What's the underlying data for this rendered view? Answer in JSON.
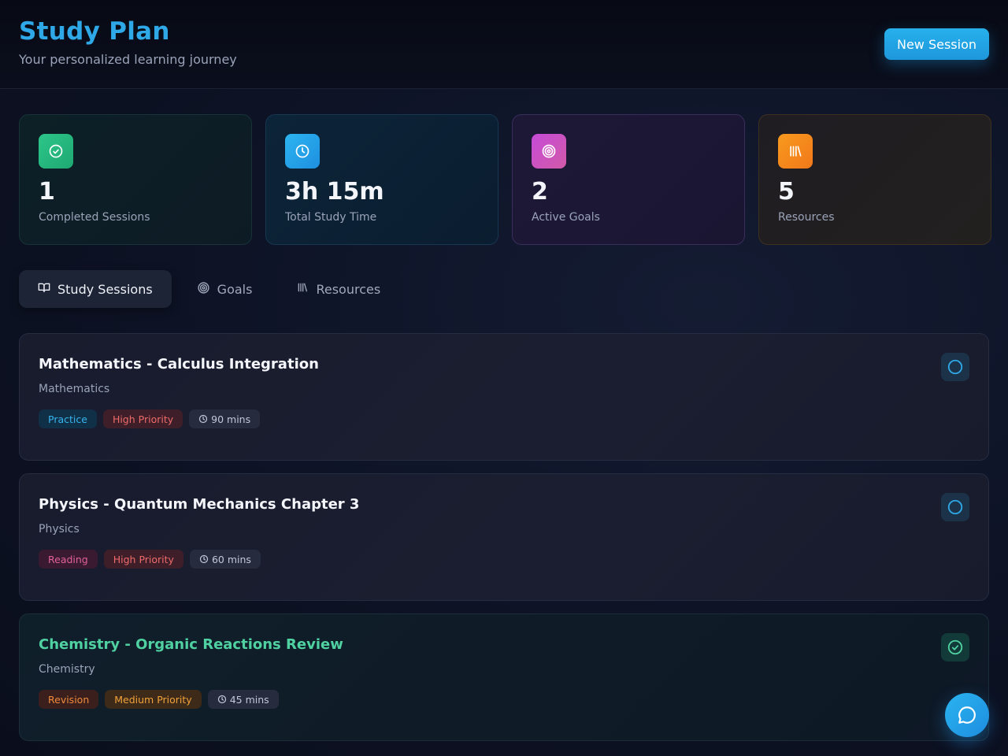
{
  "header": {
    "title": "Study Plan",
    "subtitle": "Your personalized learning journey",
    "new_session_label": "New Session"
  },
  "stats": [
    {
      "value": "1",
      "label": "Completed Sessions",
      "icon": "check-circle-icon",
      "color": "#2cc68a"
    },
    {
      "value": "3h 15m",
      "label": "Total Study Time",
      "icon": "clock-icon",
      "color": "#2cb5f0"
    },
    {
      "value": "2",
      "label": "Active Goals",
      "icon": "target-icon",
      "color": "#c64bd8"
    },
    {
      "value": "5",
      "label": "Resources",
      "icon": "library-icon",
      "color": "#f79a1e"
    }
  ],
  "tabs": [
    {
      "label": "Study Sessions",
      "icon": "book-open-icon",
      "active": true
    },
    {
      "label": "Goals",
      "icon": "target-icon",
      "active": false
    },
    {
      "label": "Resources",
      "icon": "library-icon",
      "active": false
    }
  ],
  "sessions": [
    {
      "title": "Mathematics - Calculus Integration",
      "subject": "Mathematics",
      "type": "Practice",
      "priority": "High Priority",
      "duration": "90 mins",
      "completed": false
    },
    {
      "title": "Physics - Quantum Mechanics Chapter 3",
      "subject": "Physics",
      "type": "Reading",
      "priority": "High Priority",
      "duration": "60 mins",
      "completed": false
    },
    {
      "title": "Chemistry - Organic Reactions Review",
      "subject": "Chemistry",
      "type": "Revision",
      "priority": "Medium Priority",
      "duration": "45 mins",
      "completed": true
    }
  ],
  "colors": {
    "accent": "#2fa8e8",
    "completed": "#4fd1a1"
  }
}
